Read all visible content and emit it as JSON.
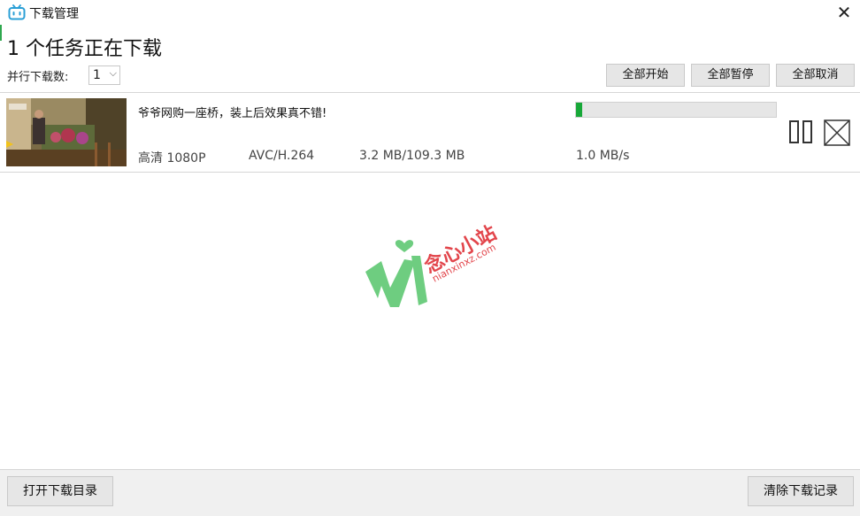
{
  "window": {
    "title": "下载管理",
    "close_glyph": "✕"
  },
  "heading": "1 个任务正在下载",
  "parallel": {
    "label": "并行下载数:",
    "value": "1",
    "chevron": "⌵"
  },
  "toolbar": {
    "start_all": "全部开始",
    "pause_all": "全部暂停",
    "cancel_all": "全部取消"
  },
  "tasks": [
    {
      "title": "爷爷网购一座桥，装上后效果真不错!",
      "quality": "高清 1080P",
      "codec": "AVC/H.264",
      "size": "3.2 MB/109.3 MB",
      "speed": "1.0 MB/s",
      "progress": 0.029
    }
  ],
  "watermark": {
    "text": "念心小站",
    "url_text": "nianxinxz.com"
  },
  "footer": {
    "open_dir": "打开下载目录",
    "clear_history": "清除下载记录"
  },
  "icons": {
    "app": "bilibili-tv-icon",
    "pause": "pause-icon",
    "cancel": "cancel-icon",
    "close": "close-icon"
  },
  "colors": {
    "accent": "#17a838",
    "app_icon": "#2a9fd6",
    "watermark_green": "#55c56a",
    "watermark_red": "#e2454b"
  }
}
